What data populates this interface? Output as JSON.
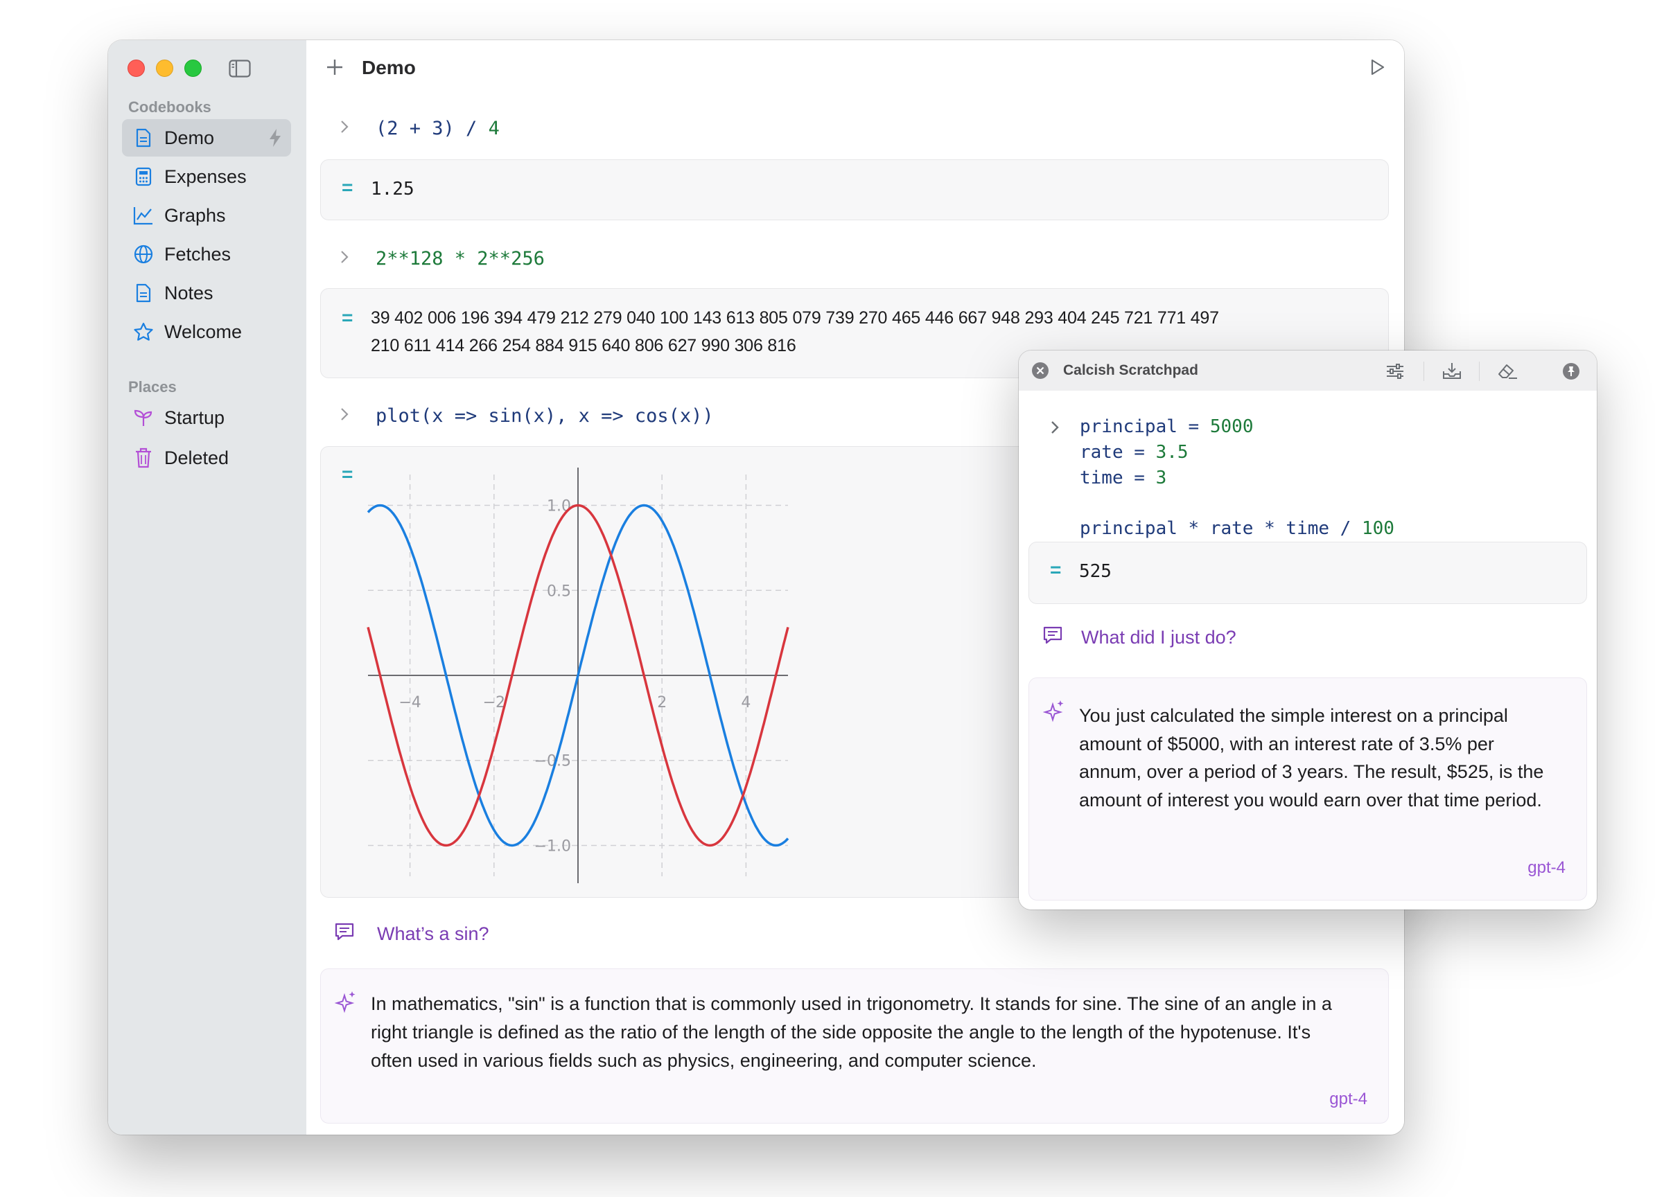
{
  "sidebar": {
    "sections": {
      "codebooks": "Codebooks",
      "places": "Places"
    },
    "codebooks": [
      {
        "label": "Demo",
        "icon": "document-icon",
        "active": true
      },
      {
        "label": "Expenses",
        "icon": "calculator-icon"
      },
      {
        "label": "Graphs",
        "icon": "chart-icon"
      },
      {
        "label": "Fetches",
        "icon": "globe-icon"
      },
      {
        "label": "Notes",
        "icon": "document-icon"
      },
      {
        "label": "Welcome",
        "icon": "star-icon"
      }
    ],
    "places": [
      {
        "label": "Startup",
        "icon": "sprout-icon"
      },
      {
        "label": "Deleted",
        "icon": "trash-icon"
      }
    ]
  },
  "toolbar": {
    "title": "Demo"
  },
  "cells": {
    "c1": {
      "input_a": "(2 + 3)",
      "input_op": " / ",
      "input_b": "4",
      "result": "1.25"
    },
    "c2": {
      "input": "2**128 * 2**256",
      "result_line1": "39 402 006 196 394 479 212 279 040 100 143 613 805 079 739 270 465 446 667 948 293 404 245 721 771 497",
      "result_line2": "210 611 414 266 254 884 915 640 806 627 990 306 816"
    },
    "c3": {
      "input": "plot(x => sin(x), x => cos(x))"
    }
  },
  "question": "What’s a sin?",
  "answer": "In mathematics, \"sin\" is a function that is commonly used in trigonometry. It stands for sine. The sine of an angle in a right triangle is defined as the ratio of the length of the side opposite the angle to the length of the hypotenuse. It's often used in various fields such as physics, engineering, and computer science.",
  "answer_model": "gpt-4",
  "chart_data": {
    "type": "line",
    "title": "",
    "xlabel": "",
    "ylabel": "",
    "xlim": [
      -5,
      5
    ],
    "ylim": [
      -1.1,
      1.1
    ],
    "x_ticks": [
      -4,
      -2,
      2,
      4
    ],
    "x_tick_labels": [
      "−4",
      "−2",
      "2",
      "4"
    ],
    "y_ticks": [
      1.0,
      0.5,
      -0.5,
      -1.0
    ],
    "y_tick_labels": [
      "1.0",
      "0.5",
      "−0.5",
      "−1.0"
    ],
    "grid": true,
    "series": [
      {
        "function": "sin(x)",
        "color": "#1a7fe0"
      },
      {
        "function": "cos(x)",
        "color": "#d8363e"
      }
    ]
  },
  "scratchpad": {
    "title": "Calcish Scratchpad",
    "lines": [
      {
        "name": "principal",
        "op": " = ",
        "value": "5000"
      },
      {
        "name": "rate",
        "op": " = ",
        "value": "3.5"
      },
      {
        "name": "time",
        "op": " = ",
        "value": "3"
      }
    ],
    "expr": {
      "a": "principal * rate * time / ",
      "b": "100"
    },
    "result": "525",
    "question": "What did I just do?",
    "answer": "You just calculated the simple interest on a principal amount of $5000, with an interest rate of 3.5% per annum, over a period of 3 years. The result, $525, is the amount of interest you would earn over that time period.",
    "model": "gpt-4"
  },
  "colors": {
    "accent_purple": "#7a3cb3",
    "sin_blue": "#1a7fe0",
    "cos_red": "#d8363e",
    "result_marker": "#2aa7b8"
  }
}
